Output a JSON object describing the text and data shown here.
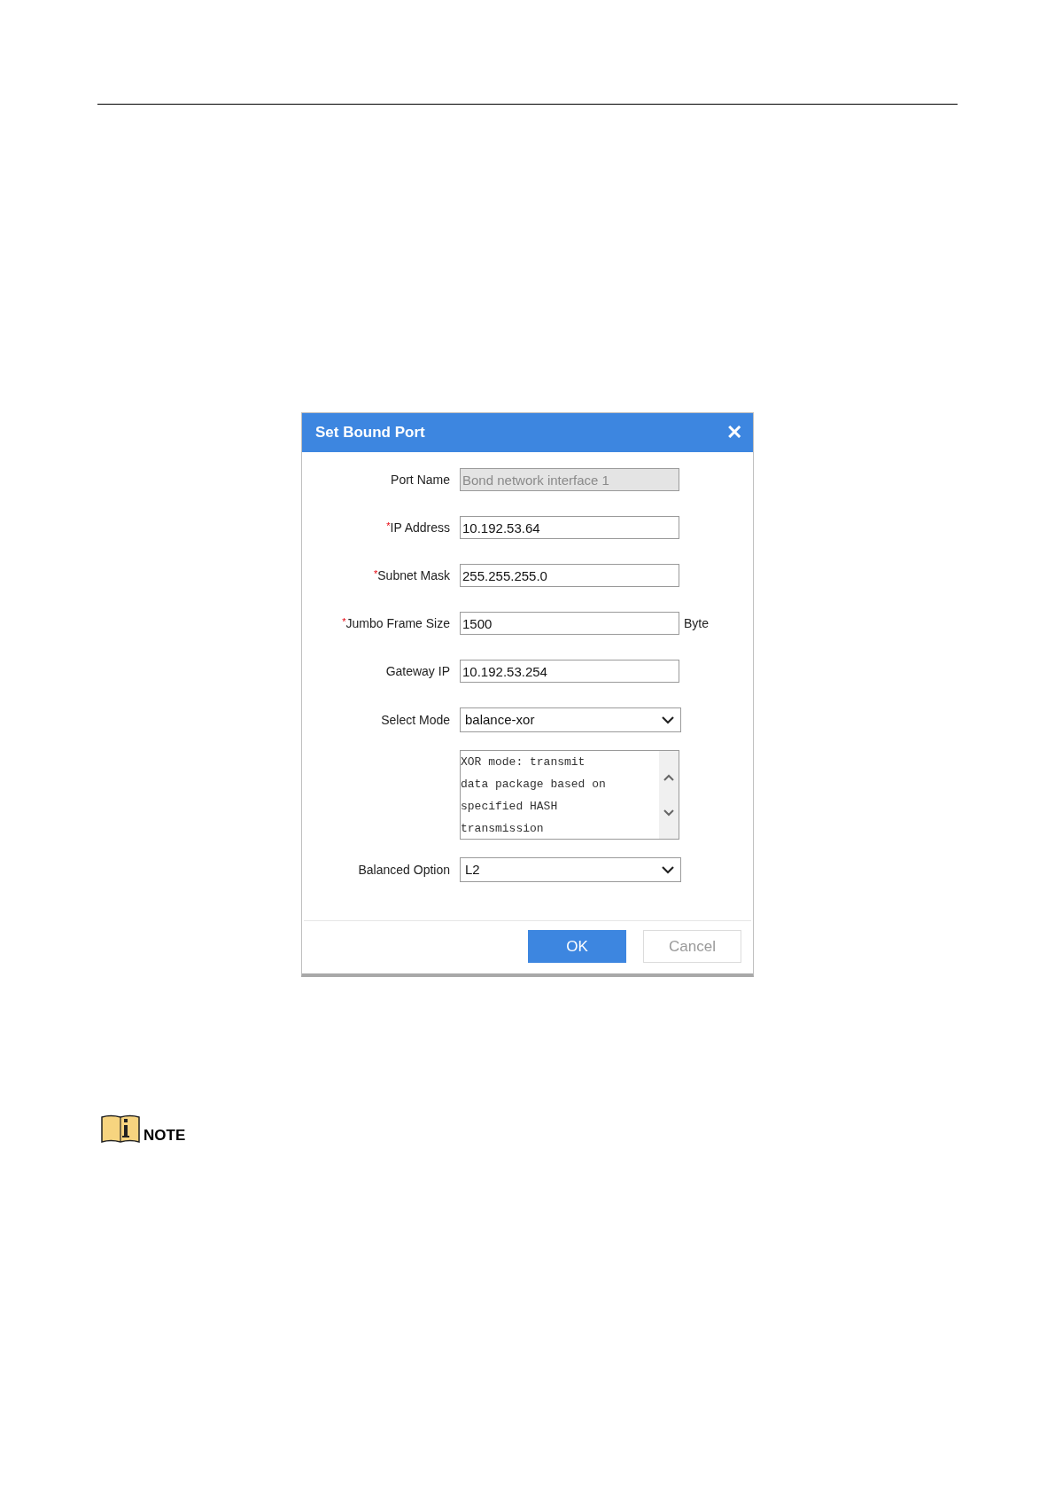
{
  "dialog": {
    "title": "Set Bound Port",
    "close": "✕",
    "fields": [
      {
        "kind": "text",
        "label": "Port Name",
        "disabled": true,
        "value": "Bond network interface 1"
      },
      {
        "kind": "text",
        "marker": "*",
        "label": "IP Address",
        "disabled": false,
        "value": "10.192.53.64"
      },
      {
        "kind": "text",
        "marker": "*",
        "label": "Subnet Mask",
        "disabled": false,
        "value": "255.255.255.0"
      },
      {
        "kind": "text",
        "marker": "*",
        "label": "Jumbo Frame Size",
        "disabled": false,
        "value": "1500",
        "unit": "Byte"
      },
      {
        "kind": "text",
        "label": "Gateway IP",
        "disabled": false,
        "value": "10.192.53.254"
      },
      {
        "kind": "select",
        "label": "Select Mode",
        "value": "balance-xor"
      },
      {
        "kind": "textarea",
        "lines": [
          "XOR mode: transmit",
          "data package based on",
          "specified HASH",
          "transmission"
        ]
      },
      {
        "kind": "select",
        "label": "Balanced Option",
        "value": "L2"
      }
    ],
    "buttons": [
      {
        "label": "OK",
        "primary": true
      },
      {
        "label": "Cancel",
        "primary": false
      }
    ]
  },
  "note": {
    "label": "NOTE"
  }
}
